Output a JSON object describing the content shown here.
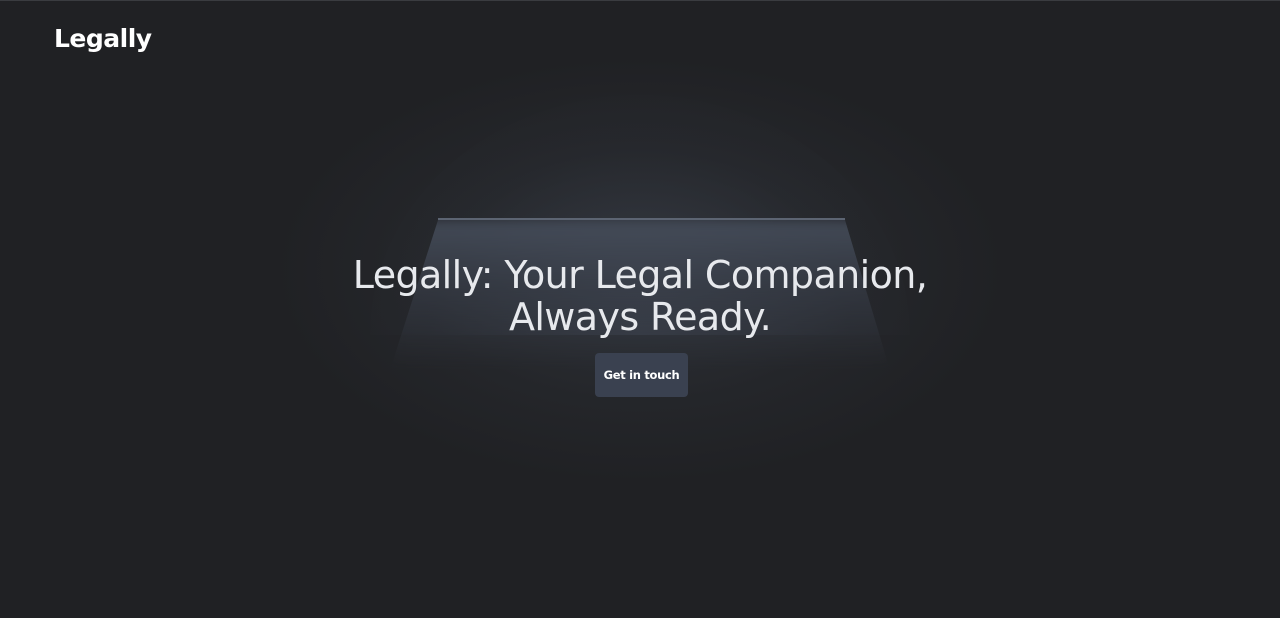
{
  "header": {
    "brand": "Legally"
  },
  "hero": {
    "headline_line1": "Legally: Your Legal Companion,",
    "headline_line2": "Always Ready.",
    "cta_label": "Get in touch"
  },
  "colors": {
    "background": "#202124",
    "button": "#3a4150",
    "headline_text": "#e7e9ed",
    "lamp_line": "#5c6472"
  }
}
